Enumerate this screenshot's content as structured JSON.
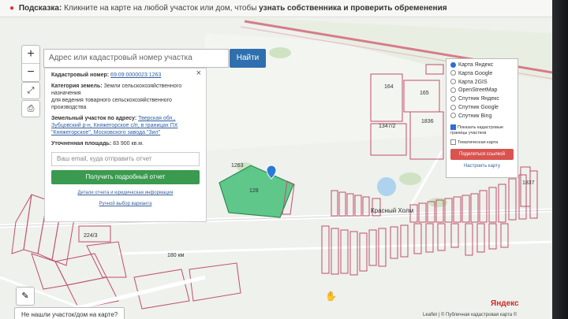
{
  "hint": {
    "prefix": "Подсказка:",
    "text": "Кликните на карте на любой участок или дом, чтобы",
    "strong": "узнать собственника и проверить обременения"
  },
  "search": {
    "placeholder": "Адрес или кадастровый номер участка",
    "button": "Найти"
  },
  "zoom": {
    "in": "+",
    "out": "−"
  },
  "card": {
    "cad_label": "Кадастровый номер:",
    "cad_value": "69:09:0000023:1263",
    "cat_label": "Категория земель:",
    "cat_value": "Земли сельскохозяйственного назначения",
    "use_value": "для ведения товарного сельскохозяйственного производства",
    "addr_label": "Земельный участок по адресу:",
    "addr_value": "Тверская обл., Зубцовский р-н, Княжегорское с/п, в границах ПХ \"Княжегорское\", Московского завода \"Зил\"",
    "area_label": "Уточненная площадь:",
    "area_value": "83 900 кв.м.",
    "email_placeholder": "Ваш email, куда отправить отчет",
    "report_button": "Получить подробный отчет",
    "details_link": "Детали отчета и юридическая информация",
    "manual_link": "Ручной выбор варианта"
  },
  "layers": {
    "options": [
      "Карта Яндекс",
      "Карта Google",
      "Карта 2GIS",
      "OpenStreetMap",
      "Спутник Яндекс",
      "Спутник Google",
      "Спутник Bing"
    ],
    "selected": "Карта Яндекс",
    "check_cadastre": "Показать кадастровые границы участков",
    "check_thematic": "Тематическая карта",
    "share_button": "Поделиться ссылкой",
    "settings_link": "Настроить карту"
  },
  "map_labels": {
    "l164": "164",
    "l165": "165",
    "l1347": "1347/2",
    "l1836": "1836",
    "l1263": "1263",
    "l128": "128",
    "l224_3": "224/3",
    "village": "Красный Холм",
    "km": "180 км",
    "l1837": "1837"
  },
  "footer": {
    "not_found": "Не нашли участок/дом на карте?",
    "yandex": "Яндекс",
    "attribution": "Leaflet | © Публичная кадастровая карта ©"
  },
  "colors": {
    "selected_parcel": "#46c07a",
    "parcel_stroke": "#c0506a",
    "report_button": "#3a9a4f",
    "share_button": "#d9534f"
  }
}
